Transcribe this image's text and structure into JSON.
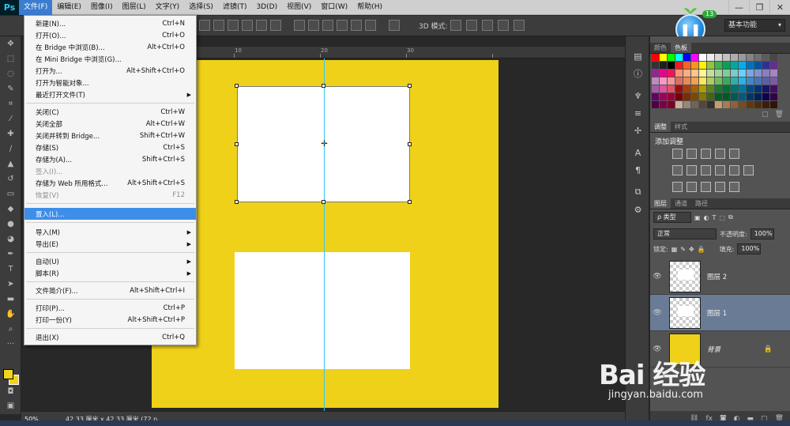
{
  "app": {
    "logo": "Ps"
  },
  "menubar": [
    "文件(F)",
    "编辑(E)",
    "图像(I)",
    "图层(L)",
    "文字(Y)",
    "选择(S)",
    "滤镜(T)",
    "3D(D)",
    "视图(V)",
    "窗口(W)",
    "帮助(H)"
  ],
  "window_controls": {
    "minimize": "—",
    "restore": "❐",
    "close": "✕"
  },
  "optionsbar": {
    "mode3d_label": "3D 模式:",
    "workspace": "基本功能"
  },
  "widget": {
    "badge": "13",
    "icon": "pause-icon"
  },
  "ruler": {
    "labels": [
      "10",
      "20",
      "30"
    ]
  },
  "file_menu": [
    {
      "label": "新建(N)...",
      "shortcut": "Ctrl+N"
    },
    {
      "label": "打开(O)...",
      "shortcut": "Ctrl+O"
    },
    {
      "label": "在 Bridge 中浏览(B)...",
      "shortcut": "Alt+Ctrl+O"
    },
    {
      "label": "在 Mini Bridge 中浏览(G)...",
      "shortcut": ""
    },
    {
      "label": "打开为...",
      "shortcut": "Alt+Shift+Ctrl+O"
    },
    {
      "label": "打开为智能对象...",
      "shortcut": ""
    },
    {
      "label": "最近打开文件(T)",
      "shortcut": "",
      "submenu": true
    },
    {
      "label": "关闭(C)",
      "shortcut": "Ctrl+W"
    },
    {
      "label": "关闭全部",
      "shortcut": "Alt+Ctrl+W"
    },
    {
      "label": "关闭并转到 Bridge...",
      "shortcut": "Shift+Ctrl+W"
    },
    {
      "label": "存储(S)",
      "shortcut": "Ctrl+S"
    },
    {
      "label": "存储为(A)...",
      "shortcut": "Shift+Ctrl+S"
    },
    {
      "label": "签入(I)...",
      "shortcut": "",
      "disabled": true
    },
    {
      "label": "存储为 Web 所用格式...",
      "shortcut": "Alt+Shift+Ctrl+S"
    },
    {
      "label": "恢复(V)",
      "shortcut": "F12",
      "disabled": true
    },
    {
      "label": "置入(L)...",
      "shortcut": "",
      "highlighted": true
    },
    {
      "label": "导入(M)",
      "shortcut": "",
      "submenu": true
    },
    {
      "label": "导出(E)",
      "shortcut": "",
      "submenu": true
    },
    {
      "label": "自动(U)",
      "shortcut": "",
      "submenu": true
    },
    {
      "label": "脚本(R)",
      "shortcut": "",
      "submenu": true
    },
    {
      "label": "文件简介(F)...",
      "shortcut": "Alt+Shift+Ctrl+I"
    },
    {
      "label": "打印(P)...",
      "shortcut": "Ctrl+P"
    },
    {
      "label": "打印一份(Y)",
      "shortcut": "Alt+Shift+Ctrl+P"
    },
    {
      "label": "退出(X)",
      "shortcut": "Ctrl+Q"
    }
  ],
  "statusbar": {
    "zoom": "50%",
    "doc_info": "42.33 厘米 x 42.33 厘米 (72 p..."
  },
  "swatch_panel": {
    "tabs": [
      "颜色",
      "色板"
    ]
  },
  "adjust_panel": {
    "tabs": [
      "调整",
      "样式"
    ],
    "title": "添加调整"
  },
  "layers_panel": {
    "tabs": [
      "图层",
      "通道",
      "路径"
    ],
    "filter_label": "ρ 类型",
    "blend_mode": "正常",
    "opacity_label": "不透明度:",
    "opacity_value": "100%",
    "lock_label": "锁定:",
    "fill_label": "填充:",
    "fill_value": "100%",
    "layers": [
      {
        "name": "图层 2",
        "selected": false,
        "background": false
      },
      {
        "name": "图层 1",
        "selected": true,
        "background": false
      },
      {
        "name": "背景",
        "selected": false,
        "background": true
      }
    ],
    "footer_icons": [
      "link-icon",
      "fx-icon",
      "mask-icon",
      "adjustment-icon",
      "folder-icon",
      "new-layer-icon",
      "trash-icon"
    ]
  },
  "watermark": {
    "logo": "Bai 经验",
    "url": "jingyan.baidu.com"
  },
  "colors": {
    "canvas": "#efd11a",
    "guide": "#32c8f0",
    "menu_highlight": "#3d8ee8",
    "selected_layer": "#6a7c95"
  }
}
